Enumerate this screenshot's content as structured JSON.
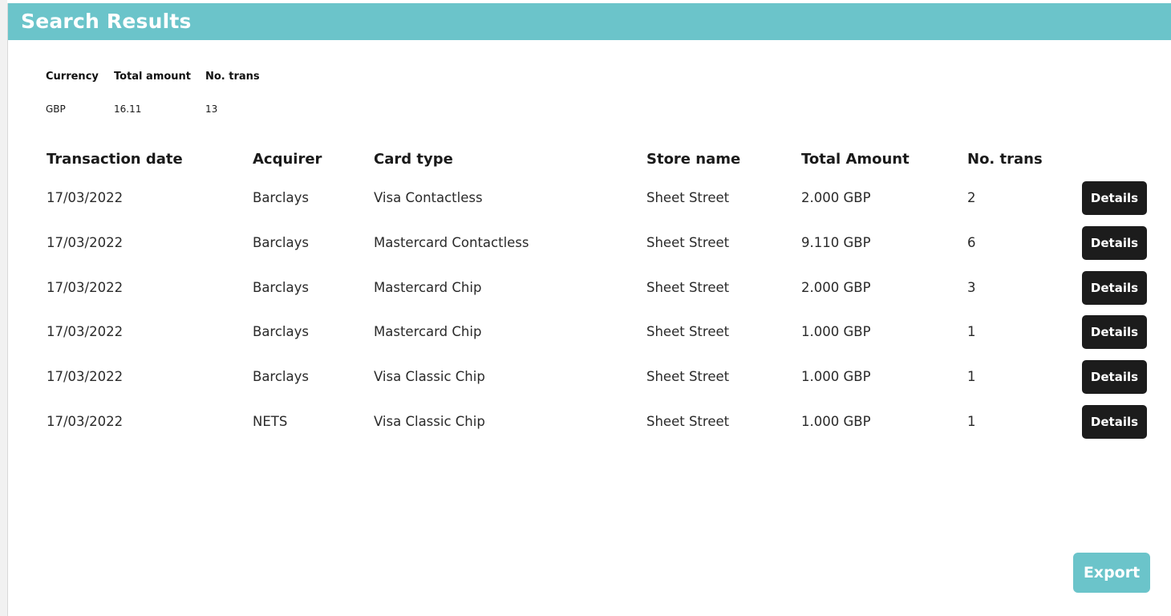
{
  "header": {
    "title": "Search Results"
  },
  "summary": {
    "columns": [
      "Currency",
      "Total amount",
      "No. trans"
    ],
    "values": [
      "GBP",
      "16.11",
      "13"
    ]
  },
  "table": {
    "columns": [
      "Transaction date",
      "Acquirer",
      "Card type",
      "Store name",
      "Total Amount",
      "No. trans"
    ],
    "rows": [
      [
        "17/03/2022",
        "Barclays",
        "Visa Contactless",
        "Sheet Street",
        "2.000 GBP",
        "2"
      ],
      [
        "17/03/2022",
        "Barclays",
        "Mastercard Contactless",
        "Sheet Street",
        "9.110 GBP",
        "6"
      ],
      [
        "17/03/2022",
        "Barclays",
        "Mastercard Chip",
        "Sheet Street",
        "2.000 GBP",
        "3"
      ],
      [
        "17/03/2022",
        "Barclays",
        "Mastercard Chip",
        "Sheet Street",
        "1.000 GBP",
        "1"
      ],
      [
        "17/03/2022",
        "Barclays",
        "Visa Classic Chip",
        "Sheet Street",
        "1.000 GBP",
        "1"
      ],
      [
        "17/03/2022",
        "NETS",
        "Visa Classic Chip",
        "Sheet Street",
        "1.000 GBP",
        "1"
      ]
    ],
    "details_label": "Details"
  },
  "footer": {
    "export_label": "Export"
  },
  "colors": {
    "accent": "#6bc4ca",
    "button_dark": "#1c1c1c"
  }
}
